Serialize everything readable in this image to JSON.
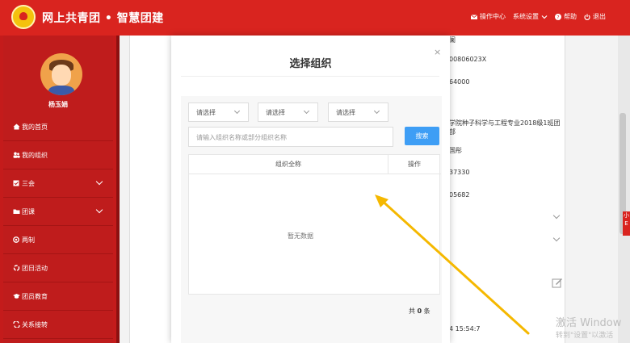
{
  "header": {
    "brand_title": "网上共青团 • 智慧团建",
    "nav": {
      "ops_center": "操作中心",
      "settings": "系统设置",
      "help": "帮助",
      "logout": "退出"
    },
    "color": "#d9241f"
  },
  "sidebar": {
    "username": "杨玉娟",
    "items": [
      {
        "label": "我的首页",
        "icon": "home-icon"
      },
      {
        "label": "我的组织",
        "icon": "group-icon"
      },
      {
        "label": "三会",
        "icon": "calendar-icon"
      },
      {
        "label": "团课",
        "icon": "folder-icon"
      },
      {
        "label": "两制",
        "icon": "circle-icon"
      },
      {
        "label": "团日活动",
        "icon": "recycle-icon"
      },
      {
        "label": "团员教育",
        "icon": "graduation-icon"
      },
      {
        "label": "关系接转",
        "icon": "transfer-icon"
      }
    ]
  },
  "background_page": {
    "texts": [
      "阑",
      "00806023X",
      "64000",
      "学院种子科学与工程专业2018级1班团",
      "部",
      "国彤",
      "37330",
      "05682",
      "4 15:54:7"
    ]
  },
  "modal": {
    "title": "选择组织",
    "close": "×",
    "selects": [
      "请选择",
      "请选择",
      "请选择"
    ],
    "search_placeholder": "请输入组织名称或部分组织名称",
    "search_button": "搜索",
    "table": {
      "col_name": "组织全称",
      "col_op": "操作",
      "empty_text": "暂无数据"
    },
    "total_prefix": "共",
    "total_count": "0",
    "total_suffix": "条"
  },
  "float_tab": "小 E",
  "watermark": {
    "line1": "激活 Window",
    "line2": "转到\"设置\"以激活"
  },
  "colors": {
    "primary_red": "#d9241f",
    "search_blue": "#3e9ef5",
    "arrow": "#f5b800"
  }
}
